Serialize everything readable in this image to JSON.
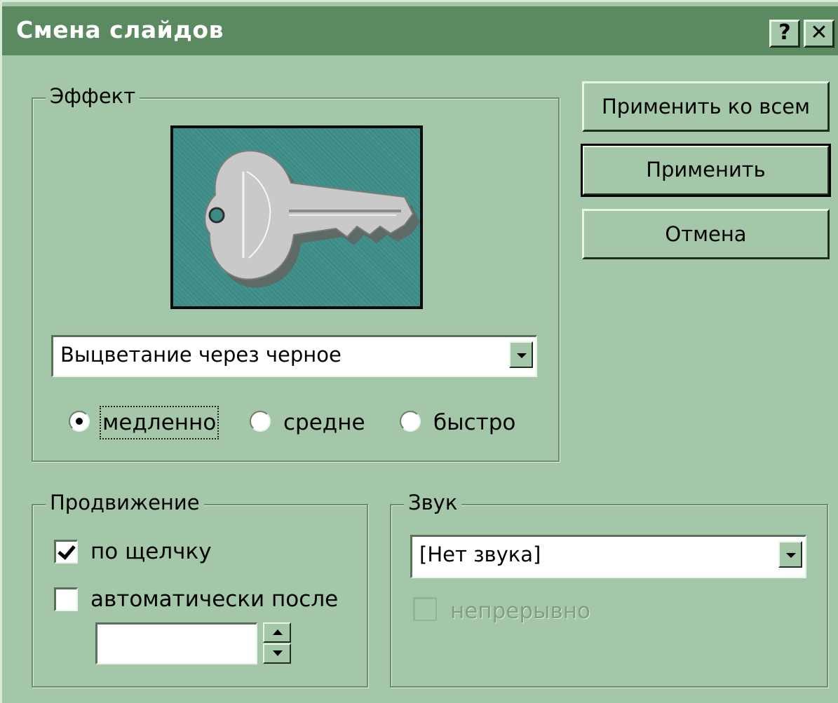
{
  "window": {
    "title": "Смена слайдов",
    "help_button": "?",
    "close_button": "✕"
  },
  "effect": {
    "group_label": "Эффект",
    "transition": "Выцветание через черное",
    "speed_options": [
      "медленно",
      "средне",
      "быстро"
    ],
    "selected_speed": "медленно"
  },
  "buttons": {
    "apply_all": "Применить ко всем",
    "apply": "Применить",
    "cancel": "Отмена"
  },
  "advance": {
    "group_label": "Продвижение",
    "on_click_label": "по щелчку",
    "on_click_checked": true,
    "auto_after_label": "автоматически после",
    "auto_after_checked": false,
    "auto_after_value": ""
  },
  "sound": {
    "group_label": "Звук",
    "selected": "[Нет звука]",
    "loop_label": "непрерывно",
    "loop_checked": false,
    "loop_enabled": false
  },
  "colors": {
    "dialog_bg": "#a3c7a8",
    "titlebar_bg": "#5b8a60",
    "preview_bg": "#3c8b86"
  },
  "icons": {
    "preview": "key-icon"
  }
}
